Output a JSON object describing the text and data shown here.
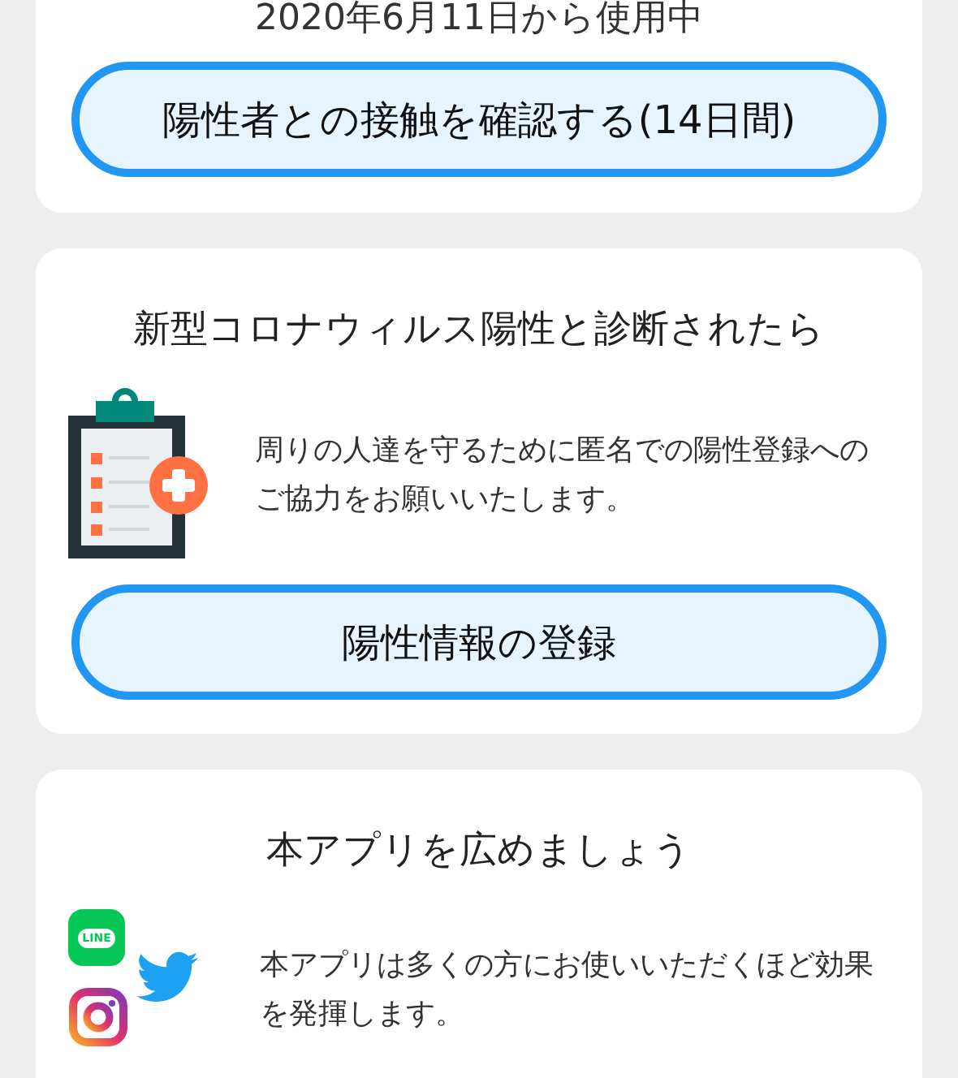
{
  "usage_card": {
    "since": "2020年6月11日から使用中",
    "button": "陽性者との接触を確認する(14日間)"
  },
  "positive_card": {
    "title": "新型コロナウィルス陽性と診断されたら",
    "text": "周りの人達を守るために匿名での陽性登録へのご協力をお願いいたします。",
    "button": "陽性情報の登録"
  },
  "share_card": {
    "title": "本アプリを広めましょう",
    "text": "本アプリは多くの方にお使いいただくほど効果を発揮します。",
    "line_logo": "LINE"
  }
}
